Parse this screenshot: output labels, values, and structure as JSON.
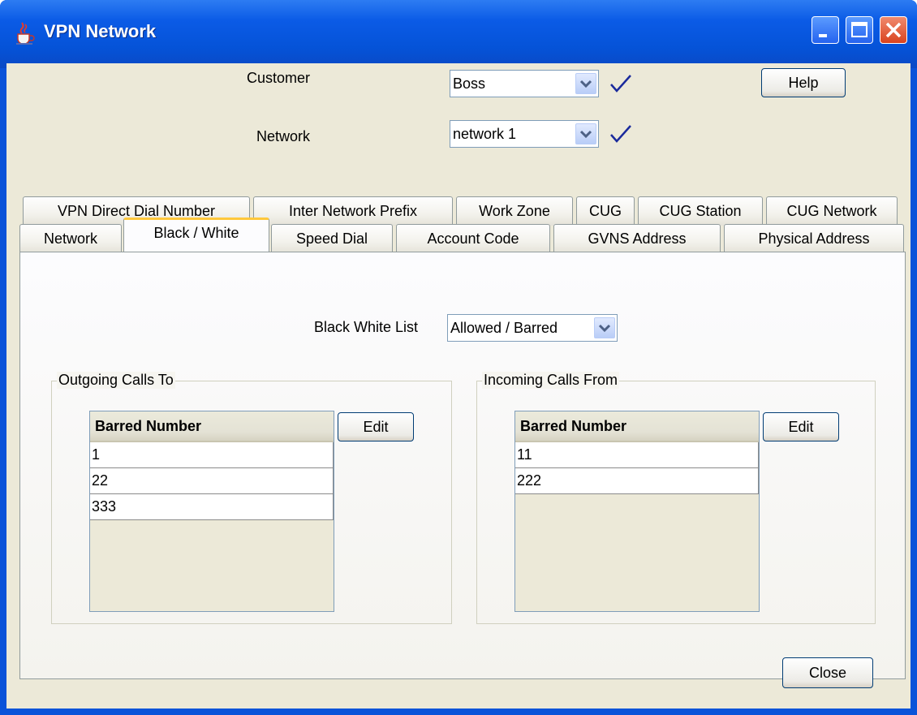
{
  "window": {
    "title": "VPN Network",
    "controls": [
      "minimize",
      "maximize",
      "close"
    ]
  },
  "header": {
    "customer_label": "Customer",
    "customer_value": "Boss",
    "network_label": "Network",
    "network_value": "network 1",
    "help_label": "Help"
  },
  "tabs": {
    "row1": [
      "VPN Direct Dial Number",
      "Inter Network Prefix",
      "Work Zone",
      "CUG",
      "CUG Station",
      "CUG Network"
    ],
    "row2": [
      "Network",
      "Black / White",
      "Speed Dial",
      "Account Code",
      "GVNS Address",
      "Physical Address"
    ],
    "active": "Black / White"
  },
  "panel": {
    "list_label": "Black White List",
    "list_value": "Allowed / Barred",
    "outgoing": {
      "title": "Outgoing Calls To",
      "column": "Barred Number",
      "rows": [
        "1",
        "22",
        "333"
      ],
      "edit_label": "Edit"
    },
    "incoming": {
      "title": "Incoming Calls From",
      "column": "Barred Number",
      "rows": [
        "11",
        "222"
      ],
      "edit_label": "Edit"
    }
  },
  "footer": {
    "close_label": "Close"
  },
  "colors": {
    "titlebar": "#0553d8",
    "client_bg": "#ece9d8",
    "active_tab_accent": "#ffc83c",
    "checkmark": "#1a2a9c"
  }
}
